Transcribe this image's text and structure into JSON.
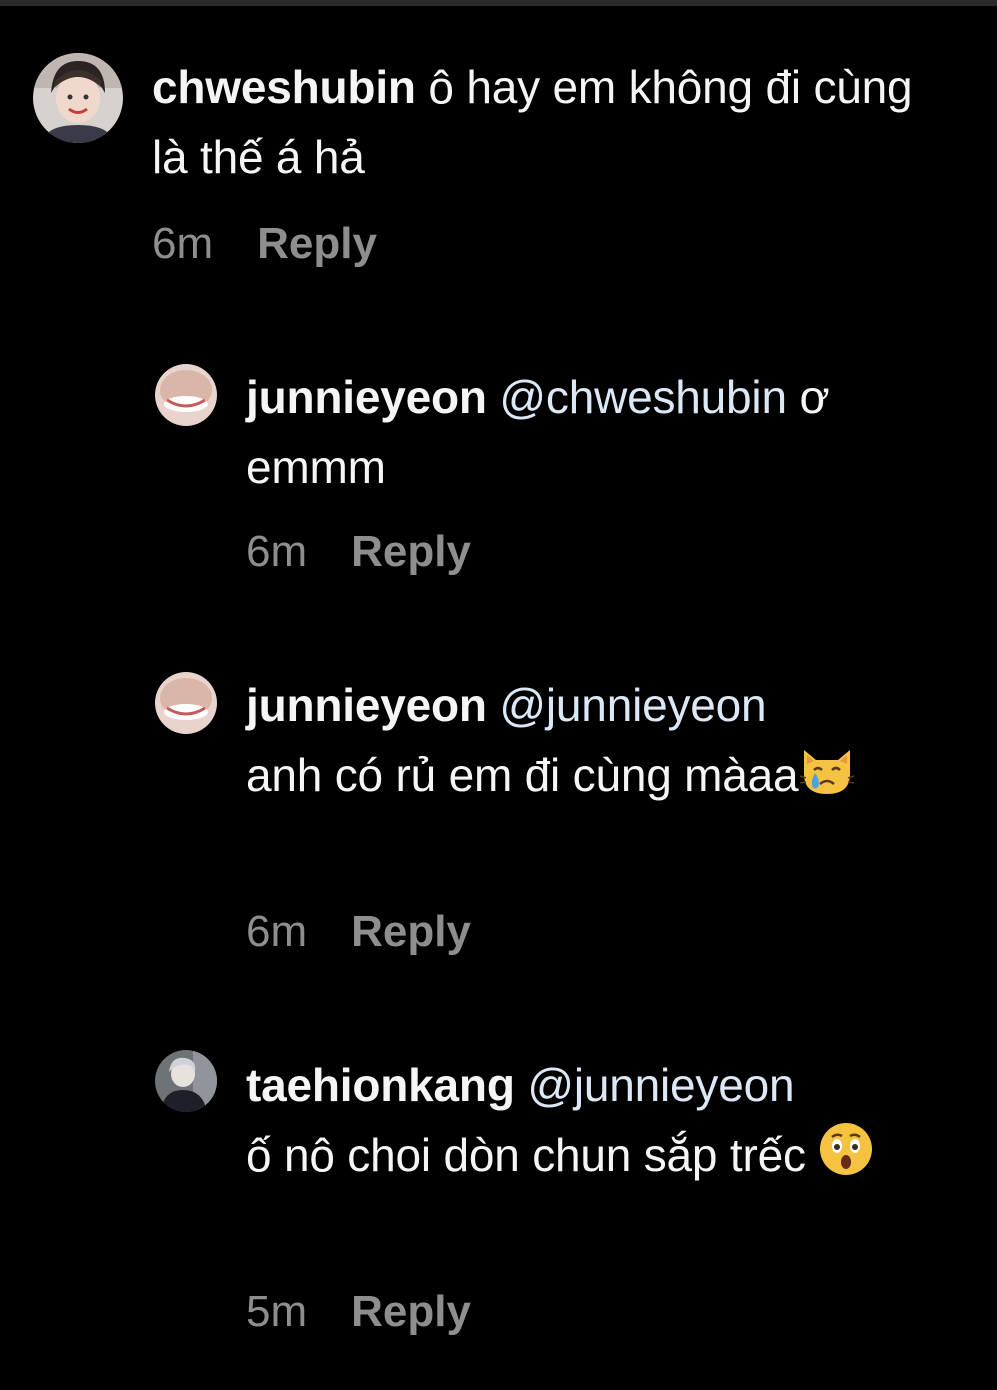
{
  "comments": [
    {
      "username": "chweshubin",
      "mention": "",
      "text": "ô hay em không đi cùng là thế á hả",
      "emoji": "",
      "time": "6m",
      "reply_label": "Reply"
    },
    {
      "username": "junnieyeon",
      "mention": "@chweshubin",
      "text": "ơ emmm",
      "emoji": "",
      "time": "6m",
      "reply_label": "Reply"
    },
    {
      "username": "junnieyeon",
      "mention": "@junnieyeon",
      "text": "anh có rủ em đi cùng màaa",
      "emoji": "crying-cat-face",
      "time": "6m",
      "reply_label": "Reply"
    },
    {
      "username": "taehionkang",
      "mention": "@junnieyeon",
      "text": "ố nô choi dòn chun sắp trếc",
      "emoji": "hushed-face",
      "time": "5m",
      "reply_label": "Reply"
    }
  ],
  "colors": {
    "background": "#000000",
    "text": "#f5f5f5",
    "mention": "#dce8f5",
    "meta": "#8e8e8e"
  }
}
